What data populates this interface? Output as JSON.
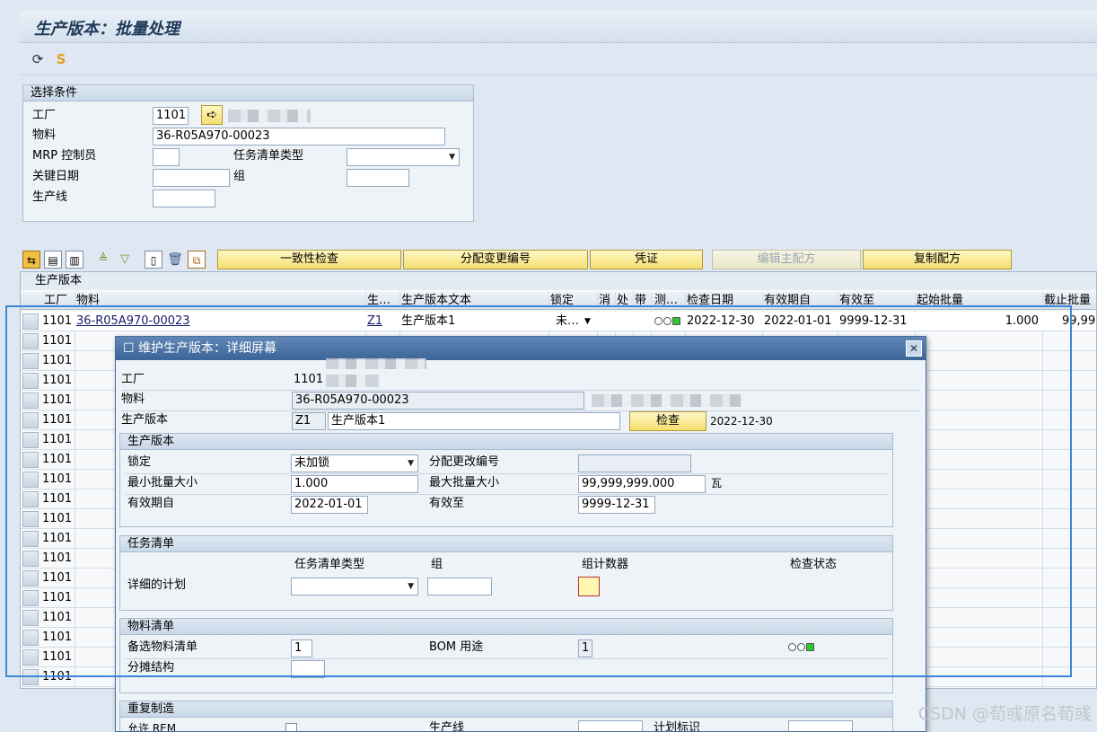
{
  "window": {
    "title": "生产版本：批量处理"
  },
  "selection": {
    "header": "选择条件",
    "plant_label": "工厂",
    "plant_value": "1101",
    "material_label": "物料",
    "material_value": "36-R05A970-00023",
    "mrp_label": "MRP 控制员",
    "tasklist_type_label": "任务清单类型",
    "key_date_label": "关键日期",
    "group_label": "组",
    "prod_line_label": "生产线"
  },
  "buttons": {
    "consistency": "一致性检查",
    "assign_change": "分配变更编号",
    "voucher": "凭证",
    "edit_master": "编辑主配方",
    "copy_recipe": "复制配方"
  },
  "grid": {
    "title": "生产版本",
    "columns": [
      "工厂",
      "物料",
      "生…",
      "生产版本文本",
      "锁定",
      "消",
      "处",
      "带",
      "测…",
      "检查日期",
      "有效期自",
      "有效至",
      "起始批量",
      "截止批量"
    ],
    "first_row": {
      "plant": "1101",
      "material": "36-R05A970-00023",
      "version": "Z1",
      "text": "生产版本1",
      "lock": "未…",
      "check_date": "2022-12-30",
      "valid_from": "2022-01-01",
      "valid_to": "9999-12-31",
      "from_lot": "1.000",
      "to_lot": "99,99"
    },
    "rows": [
      "1101",
      "1101",
      "1101",
      "1101",
      "1101",
      "1101",
      "1101",
      "1101",
      "1101",
      "1101",
      "1101",
      "1101",
      "1101",
      "1101",
      "1101",
      "1101",
      "1101",
      "1101"
    ]
  },
  "dialog": {
    "title": "维护生产版本：详细屏幕",
    "plant_label": "工厂",
    "plant_value": "1101",
    "material_label": "物料",
    "material_value": "36-R05A970-00023",
    "version_label": "生产版本",
    "version_code": "Z1",
    "version_text": "生产版本1",
    "check_button": "检查",
    "check_date": "2022-12-30",
    "pv_section": "生产版本",
    "lock_label": "锁定",
    "lock_value": "未加锁",
    "assign_change_label": "分配更改编号",
    "min_lot_label": "最小批量大小",
    "min_lot_value": "1.000",
    "max_lot_label": "最大批量大小",
    "max_lot_value": "99,999,999.000",
    "unit": "瓦",
    "valid_from_label": "有效期自",
    "valid_from_value": "2022-01-01",
    "valid_to_label": "有效至",
    "valid_to_value": "9999-12-31",
    "tasklist_section": "任务清单",
    "tl_type_col": "任务清单类型",
    "tl_group_col": "组",
    "tl_counter_col": "组计数器",
    "tl_status_col": "检查状态",
    "detail_plan_label": "详细的计划",
    "bom_section": "物料清单",
    "alt_bom_label": "备选物料清单",
    "alt_bom_value": "1",
    "bom_usage_label": "BOM 用途",
    "bom_usage_value": "1",
    "apportion_label": "分摊结构",
    "rem_section": "重复制造",
    "allow_rem_label": "允许 REM",
    "prod_line_label": "生产线",
    "plan_id_label": "计划标识"
  },
  "watermark": "CSDN @荀彧原名荀彧"
}
